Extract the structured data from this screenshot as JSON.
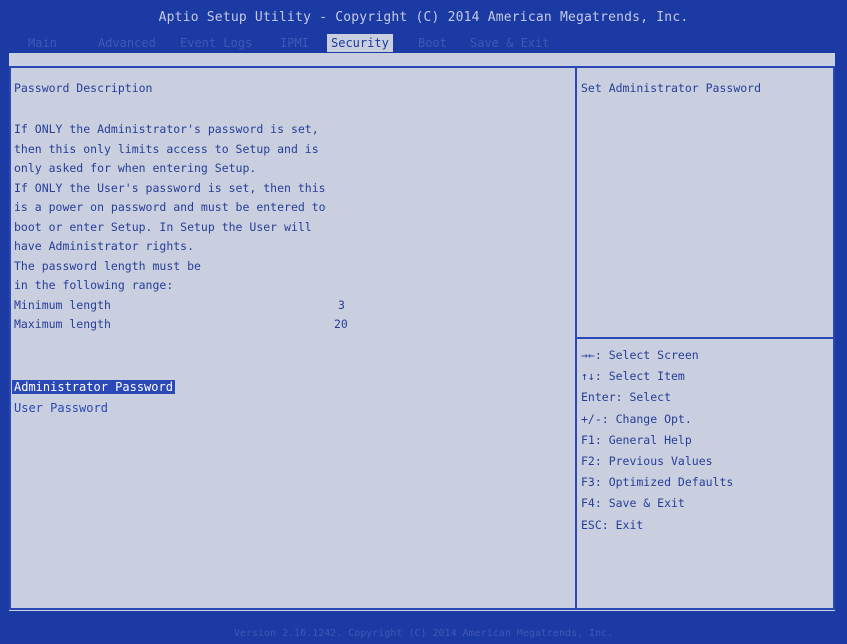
{
  "header": {
    "title": "Aptio Setup Utility - Copyright (C) 2014 American Megatrends, Inc.",
    "tabs": {
      "main": "Main",
      "advanced": "Advanced",
      "event_logs": "Event Logs",
      "ipmi": "IPMI",
      "security": "Security",
      "boot": "Boot",
      "save_exit": "Save & Exit"
    }
  },
  "left": {
    "section_title": "Password Description",
    "description": [
      "If ONLY the Administrator's password is set,",
      "then this only limits access to Setup and is",
      "only asked for when entering Setup.",
      "If ONLY the User's password is set, then this",
      "is a power on password and must be entered to",
      "boot or enter Setup. In Setup the User will",
      "have Administrator rights.",
      "The password length must be",
      "in the following range:"
    ],
    "min_label": "Minimum length",
    "min_value": "3",
    "max_label": "Maximum length",
    "max_value": "20",
    "menu": {
      "admin_password": "Administrator Password",
      "user_password": "User Password"
    }
  },
  "right": {
    "help": "Set Administrator Password",
    "keys": [
      "→←: Select Screen",
      "↑↓: Select Item",
      "Enter: Select",
      "+/-: Change Opt.",
      "F1: General Help",
      "F2: Previous Values",
      "F3: Optimized Defaults",
      "F4: Save & Exit",
      "ESC: Exit"
    ]
  },
  "footer": {
    "text": "Version 2.16.1242. Copyright (C) 2014 American Megatrends, Inc."
  }
}
